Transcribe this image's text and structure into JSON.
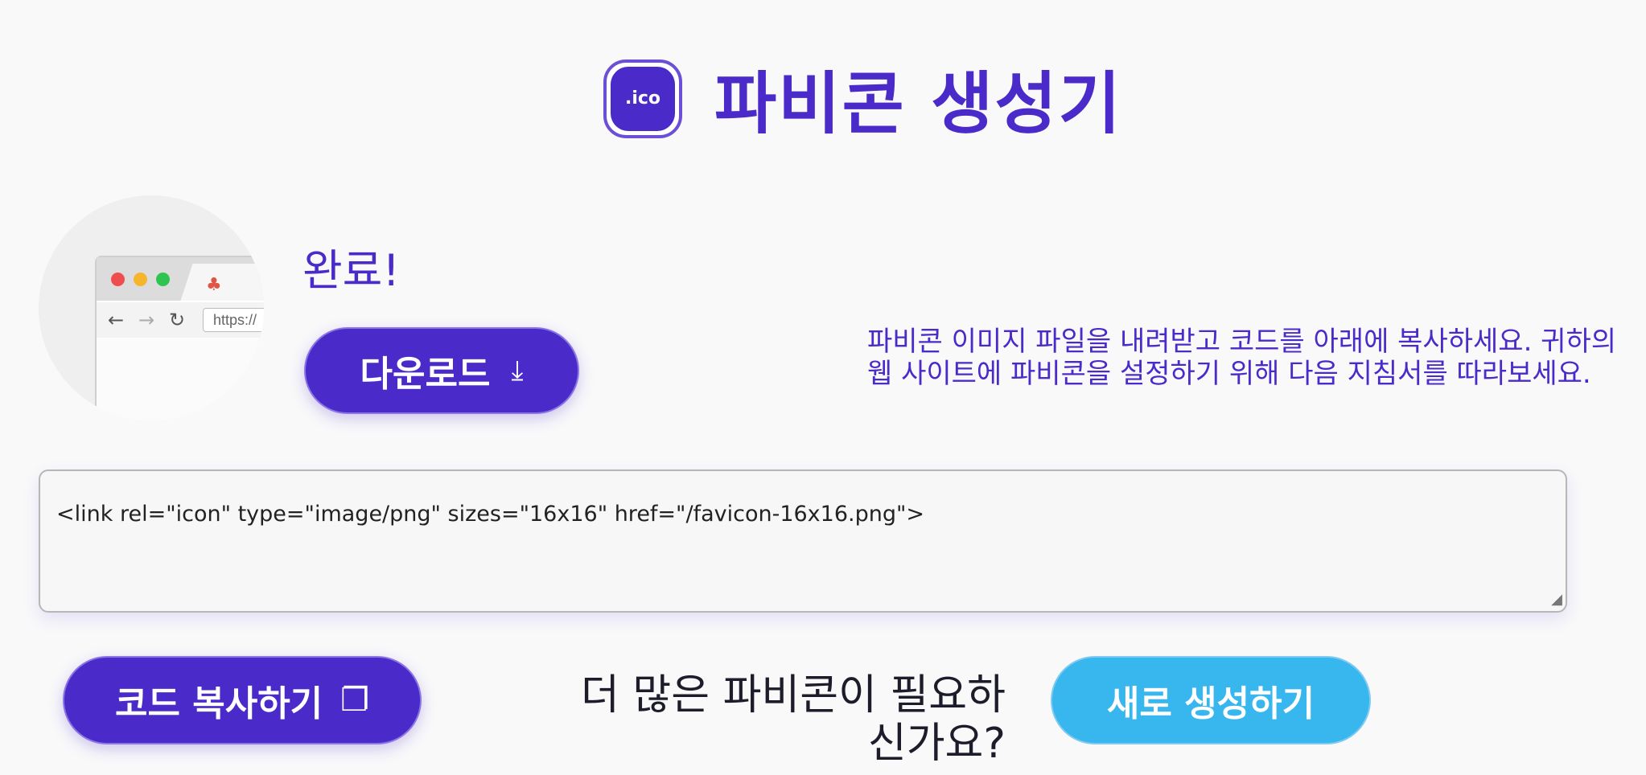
{
  "header": {
    "logo_text": ".ico",
    "title": "파비콘 생성기"
  },
  "preview": {
    "url_text": "https://",
    "dots": [
      "#ef4e4e",
      "#f5b62b",
      "#2fc34f"
    ],
    "tab_icon": "favicon-cubes-icon"
  },
  "result": {
    "complete_label": "완료!",
    "download_label": "다운로드",
    "instructions": "파비콘 이미지 파일을 내려받고 코드를 아래에 복사하세요. 귀하의 웹 사이트에 파비콘을 설정하기 위해 다음 지침서를 따라보세요."
  },
  "code": {
    "value": "<link rel=\"icon\" type=\"image/png\" sizes=\"16x16\" href=\"/favicon-16x16.png\">"
  },
  "actions": {
    "copy_label": "코드 복사하기",
    "more_prompt": "더 많은 파비콘이 필요하신가요?",
    "new_label": "새로 생성하기"
  },
  "colors": {
    "primary": "#4a2ac9",
    "secondary": "#38b6ee",
    "background": "#f9f9fa"
  }
}
